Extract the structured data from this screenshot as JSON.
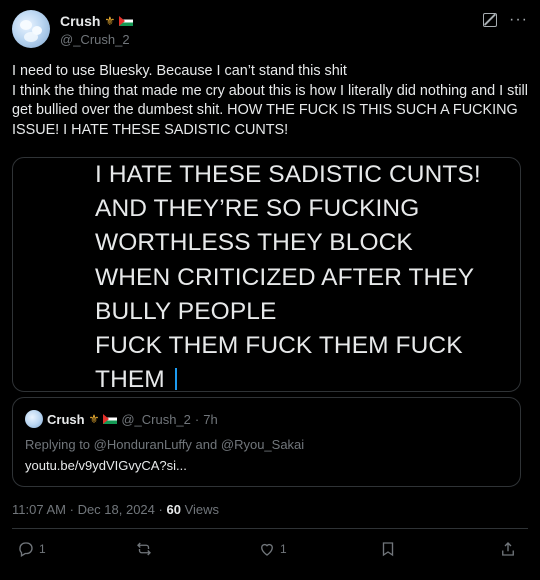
{
  "user": {
    "display_name": "Crush",
    "handle": "@_Crush_2",
    "crown_glyph": "⚜"
  },
  "tweet": {
    "lines": [
      "I need to use Bluesky. Because I can’t stand this shit",
      "I think the thing that made me cry about this is how I literally did nothing and I still get bullied over the dumbest shit. HOW THE FUCK IS THIS SUCH A FUCKING ISSUE!  I HATE THESE SADISTIC CUNTS!"
    ]
  },
  "media": {
    "lines": [
      "I HATE THESE SADISTIC CUNTS!",
      "AND THEY’RE SO FUCKING",
      "WORTHLESS THEY BLOCK",
      "WHEN CRITICIZED AFTER THEY",
      "BULLY PEOPLE",
      "FUCK THEM FUCK THEM FUCK",
      "THEM"
    ]
  },
  "quote": {
    "display_name": "Crush",
    "handle": "@_Crush_2",
    "sep": "·",
    "time": "7h",
    "replying_prefix": "Replying to",
    "reply_user1": "@HonduranLuffy",
    "reply_and": "and",
    "reply_user2": "@Ryou_Sakai",
    "link": "youtu.be/v9ydVIGvyCA?si..."
  },
  "meta": {
    "time": "11:07 AM",
    "sep": "·",
    "date": "Dec 18, 2024",
    "views_count": "60",
    "views_label": "Views"
  },
  "actions": {
    "reply_count": "1",
    "repost_count": "",
    "like_count": "1"
  },
  "colors": {
    "background": "#000000",
    "text": "#e7e9ea",
    "muted": "#71767b",
    "border": "#2f3336",
    "caret": "#1d9bf0"
  }
}
